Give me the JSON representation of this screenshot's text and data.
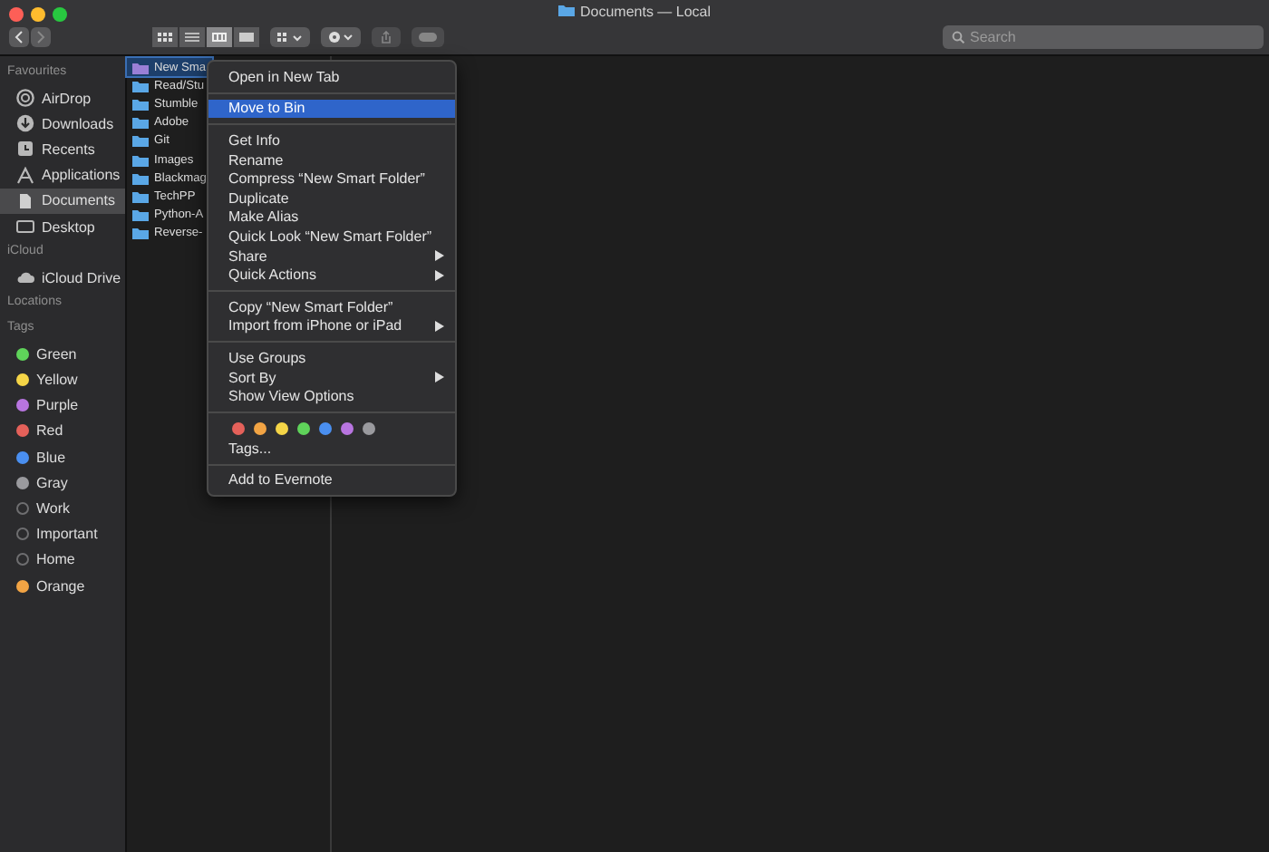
{
  "window": {
    "title": "Documents — Local"
  },
  "search": {
    "placeholder": "Search"
  },
  "toolbar": {
    "view_modes": [
      {
        "kind": "icons",
        "selected": false
      },
      {
        "kind": "list",
        "selected": false
      },
      {
        "kind": "columns",
        "selected": true
      },
      {
        "kind": "gallery",
        "selected": false
      }
    ]
  },
  "sidebar": {
    "sections": [
      {
        "title": "Favourites",
        "items": [
          {
            "label": "AirDrop",
            "kind": "airdrop",
            "selected": false
          },
          {
            "label": "Downloads",
            "kind": "downloads",
            "selected": false
          },
          {
            "label": "Recents",
            "kind": "recents",
            "selected": false
          },
          {
            "label": "Applications",
            "kind": "applications",
            "selected": false
          },
          {
            "label": "Documents",
            "kind": "documents",
            "selected": true
          },
          {
            "label": "Desktop",
            "kind": "desktop",
            "selected": false
          }
        ]
      },
      {
        "title": "iCloud",
        "items": [
          {
            "label": "iCloud Drive",
            "kind": "cloud",
            "selected": false
          }
        ]
      },
      {
        "title": "Locations"
      },
      {
        "title": "Tags",
        "items": [
          {
            "label": "Green",
            "kind": "tag",
            "color": "#5fd35a",
            "selected": false
          },
          {
            "label": "Yellow",
            "kind": "tag",
            "color": "#f5d547",
            "selected": false
          },
          {
            "label": "Purple",
            "kind": "tag",
            "color": "#b875e0",
            "selected": false
          },
          {
            "label": "Red",
            "kind": "tag",
            "color": "#e5615a",
            "selected": false
          },
          {
            "label": "Blue",
            "kind": "tag",
            "color": "#4a8ff0",
            "selected": false
          },
          {
            "label": "Gray",
            "kind": "tag",
            "color": "#9a9a9e",
            "selected": false
          },
          {
            "label": "Work",
            "kind": "tag",
            "selected": false
          },
          {
            "label": "Important",
            "kind": "tag",
            "selected": false
          },
          {
            "label": "Home",
            "kind": "tag",
            "selected": false
          },
          {
            "label": "Orange",
            "kind": "tag",
            "color": "#f2a444",
            "selected": false
          }
        ]
      }
    ]
  },
  "files": [
    {
      "name": "New Sma",
      "kind": "smart",
      "selected": true
    },
    {
      "name": "Read/Stu",
      "kind": "folder",
      "selected": false
    },
    {
      "name": "Stumble",
      "kind": "folder",
      "selected": false
    },
    {
      "name": "Adobe",
      "kind": "folder",
      "selected": false
    },
    {
      "name": "Git",
      "kind": "folder",
      "selected": false
    },
    {
      "name": "Images",
      "kind": "folder",
      "selected": false
    },
    {
      "name": "Blackmag",
      "kind": "folder",
      "selected": false
    },
    {
      "name": "TechPP",
      "kind": "folder",
      "selected": false
    },
    {
      "name": "Python-A",
      "kind": "folder",
      "selected": false
    },
    {
      "name": "Reverse-",
      "kind": "folder",
      "selected": false
    }
  ],
  "context_menu": {
    "sections": [
      [
        {
          "label": "Open in New Tab",
          "submenu": false,
          "selected": false
        }
      ],
      [
        {
          "label": "Move to Bin",
          "submenu": false,
          "selected": true
        }
      ],
      [
        {
          "label": "Get Info",
          "submenu": false,
          "selected": false
        },
        {
          "label": "Rename",
          "submenu": false,
          "selected": false
        },
        {
          "label": "Compress “New Smart Folder”",
          "submenu": false,
          "selected": false
        },
        {
          "label": "Duplicate",
          "submenu": false,
          "selected": false
        },
        {
          "label": "Make Alias",
          "submenu": false,
          "selected": false
        },
        {
          "label": "Quick Look “New Smart Folder”",
          "submenu": false,
          "selected": false
        },
        {
          "label": "Share",
          "submenu": true,
          "selected": false
        },
        {
          "label": "Quick Actions",
          "submenu": true,
          "selected": false
        }
      ],
      [
        {
          "label": "Copy “New Smart Folder”",
          "submenu": false,
          "selected": false
        },
        {
          "label": "Import from iPhone or iPad",
          "submenu": true,
          "selected": false
        }
      ],
      [
        {
          "label": "Use Groups",
          "submenu": false,
          "selected": false
        },
        {
          "label": "Sort By",
          "submenu": true,
          "selected": false
        },
        {
          "label": "Show View Options",
          "submenu": false,
          "selected": false
        }
      ]
    ],
    "tag_colors": [
      {
        "color": "#e5615a"
      },
      {
        "color": "#f2a444"
      },
      {
        "color": "#f5d547"
      },
      {
        "color": "#5fd35a"
      },
      {
        "color": "#4a8ff0"
      },
      {
        "color": "#b875e0"
      },
      {
        "color": "#9a9a9e"
      }
    ],
    "tags_item": "Tags...",
    "extra_items": [
      {
        "label": "Add to Evernote",
        "submenu": false,
        "selected": false
      }
    ]
  }
}
